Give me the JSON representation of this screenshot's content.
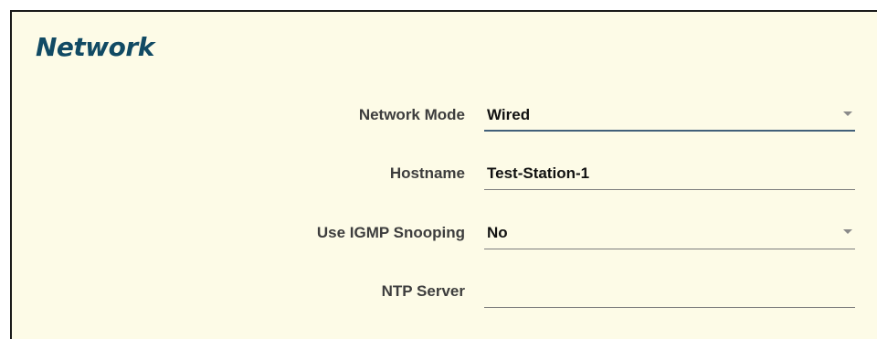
{
  "panel": {
    "title": "Network"
  },
  "form": {
    "network_mode": {
      "label": "Network Mode",
      "value": "Wired",
      "type": "select"
    },
    "hostname": {
      "label": "Hostname",
      "value": "Test-Station-1",
      "type": "text"
    },
    "igmp_snooping": {
      "label": "Use IGMP Snooping",
      "value": "No",
      "type": "select"
    },
    "ntp_server": {
      "label": "NTP Server",
      "value": "",
      "type": "text"
    }
  },
  "icons": {
    "dropdown": "dropdown-caret-icon"
  },
  "colors": {
    "background": "#fdfbe7",
    "title": "#114a64",
    "label": "#3d3d3d",
    "value": "#111111",
    "underline": "#7d7d7d",
    "active_underline": "#42607a"
  }
}
